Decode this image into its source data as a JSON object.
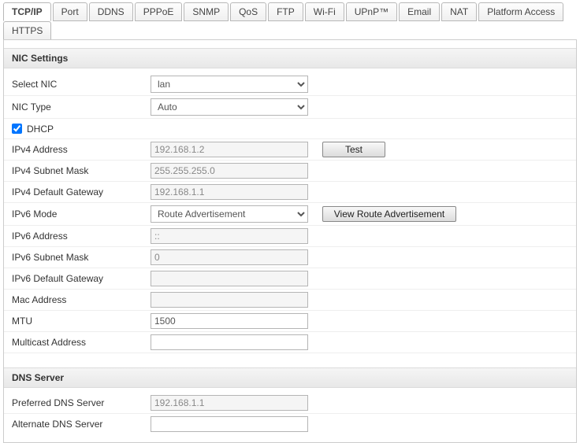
{
  "tabs": {
    "t0": "TCP/IP",
    "t1": "Port",
    "t2": "DDNS",
    "t3": "PPPoE",
    "t4": "SNMP",
    "t5": "QoS",
    "t6": "FTP",
    "t7": "Wi-Fi",
    "t8": "UPnP™",
    "t9": "Email",
    "t10": "NAT",
    "t11": "Platform Access",
    "t12": "HTTPS"
  },
  "sections": {
    "nic": "NIC Settings",
    "dns": "DNS Server"
  },
  "labels": {
    "select_nic": "Select NIC",
    "nic_type": "NIC Type",
    "dhcp": "DHCP",
    "ipv4_addr": "IPv4 Address",
    "ipv4_mask": "IPv4 Subnet Mask",
    "ipv4_gw": "IPv4 Default Gateway",
    "ipv6_mode": "IPv6 Mode",
    "ipv6_addr": "IPv6 Address",
    "ipv6_mask": "IPv6 Subnet Mask",
    "ipv6_gw": "IPv6 Default Gateway",
    "mac": "Mac Address",
    "mtu": "MTU",
    "multicast": "Multicast Address",
    "pref_dns": "Preferred DNS Server",
    "alt_dns": "Alternate DNS Server"
  },
  "values": {
    "select_nic": "lan",
    "nic_type": "Auto",
    "dhcp_checked": true,
    "ipv4_addr": "192.168.1.2",
    "ipv4_mask": "255.255.255.0",
    "ipv4_gw": "192.168.1.1",
    "ipv6_mode": "Route Advertisement",
    "ipv6_addr": "::",
    "ipv6_mask": "0",
    "ipv6_gw": "",
    "mac": "",
    "mtu": "1500",
    "multicast": "",
    "pref_dns": "192.168.1.1",
    "alt_dns": ""
  },
  "buttons": {
    "test": "Test",
    "view_ra": "View Route Advertisement"
  }
}
